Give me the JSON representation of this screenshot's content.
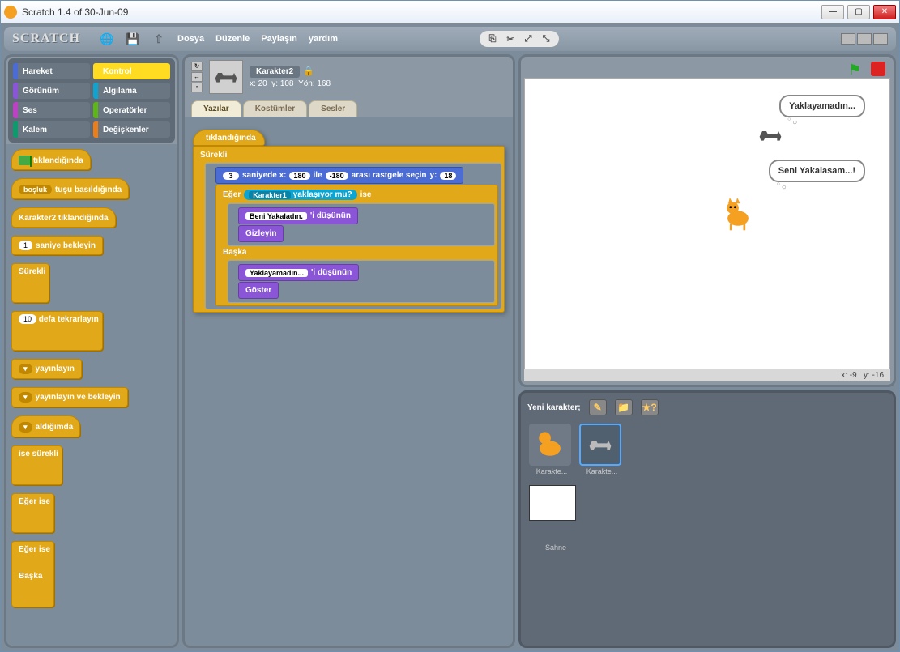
{
  "window": {
    "title": "Scratch 1.4 of 30-Jun-09"
  },
  "menu": {
    "logo": "SCRATCH",
    "items": [
      "Dosya",
      "Düzenle",
      "Paylaşın",
      "yardım"
    ]
  },
  "categories": [
    {
      "key": "motion",
      "label": "Hareket"
    },
    {
      "key": "control",
      "label": "Kontrol",
      "selected": true
    },
    {
      "key": "looks",
      "label": "Görünüm"
    },
    {
      "key": "sensing",
      "label": "Algılama"
    },
    {
      "key": "sound",
      "label": "Ses"
    },
    {
      "key": "operators",
      "label": "Operatörler"
    },
    {
      "key": "pen",
      "label": "Kalem"
    },
    {
      "key": "variables",
      "label": "Değişkenler"
    }
  ],
  "palette": {
    "hat_flag": "tıklandığında",
    "hat_key_pre": "",
    "hat_key_dd": "boşluk",
    "hat_key_post": "tuşu basıldığında",
    "hat_sprite": "Karakter2  tıklandığında",
    "wait_num": "1",
    "wait_txt": "saniye bekleyin",
    "forever": "Sürekli",
    "repeat_num": "10",
    "repeat_txt": "defa tekrarlayın",
    "broadcast": "yayınlayın",
    "broadcast_wait": "yayınlayın ve bekleyin",
    "receive": "aldığımda",
    "forever_if": "ise sürekli",
    "if": "Eğer",
    "if_suffix": "ise",
    "else": "Başka"
  },
  "sprite": {
    "name": "Karakter2",
    "x_label": "x:",
    "x": "20",
    "y_label": "y:",
    "y": "108",
    "dir_label": "Yön:",
    "dir": "168"
  },
  "tabs": {
    "scripts": "Yazılar",
    "costumes": "Kostümler",
    "sounds": "Sesler"
  },
  "script": {
    "hat": "tıklandığında",
    "forever": "Sürekli",
    "glide_s": "3",
    "glide_t1": "saniyede x:",
    "glide_x1": "180",
    "glide_t2": "ile",
    "glide_x2": "-180",
    "glide_t3": "arası rastgele seçin",
    "glide_t4": "y:",
    "glide_y": "18",
    "if": "Eğer",
    "if_dd": "Karakter1",
    "if_sens": "yaklaşıyor mu?",
    "if_suf": "ise",
    "think1_val": "Beni Yakaladın.",
    "think_suf": "'i düşünün",
    "hide": "Gizleyin",
    "else": "Başka",
    "think2_val": "Yaklayamadın...",
    "show": "Göster"
  },
  "stage": {
    "bubble1": "Yaklayamadın...",
    "bubble2": "Seni Yakalasam...!",
    "coords_x_label": "x:",
    "coords_x": "-9",
    "coords_y_label": "y:",
    "coords_y": "-16"
  },
  "spritelist": {
    "new_label": "Yeni karakter;",
    "stage_label": "Sahne",
    "sprites": [
      {
        "name": "Karakte..."
      },
      {
        "name": "Karakte...",
        "selected": true
      }
    ]
  }
}
